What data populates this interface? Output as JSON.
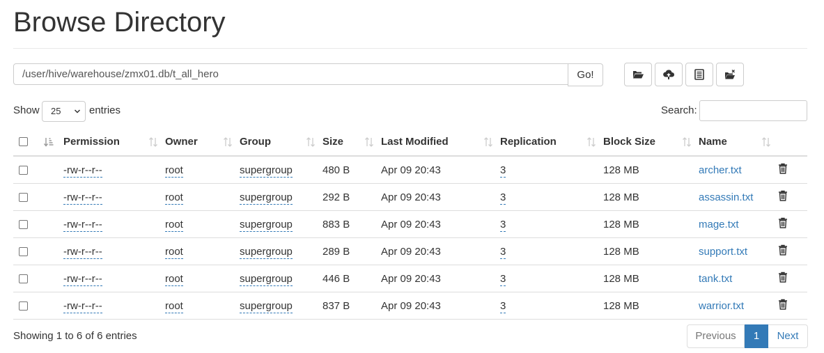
{
  "page_title": "Browse Directory",
  "path": {
    "value": "/user/hive/warehouse/zmx01.db/t_all_hero",
    "go_label": "Go!"
  },
  "toolbar": {
    "icons": [
      "folder-open-icon",
      "cloud-upload-icon",
      "list-alt-icon",
      "cut-folder-icon"
    ]
  },
  "length_menu": {
    "show_label": "Show",
    "selected": "25",
    "entries_label": "entries"
  },
  "search": {
    "label": "Search:",
    "value": ""
  },
  "table": {
    "columns": [
      "Permission",
      "Owner",
      "Group",
      "Size",
      "Last Modified",
      "Replication",
      "Block Size",
      "Name"
    ],
    "rows": [
      {
        "permission": "-rw-r--r--",
        "owner": "root",
        "group": "supergroup",
        "size": "480 B",
        "modified": "Apr 09 20:43",
        "replication": "3",
        "block_size": "128 MB",
        "name": "archer.txt"
      },
      {
        "permission": "-rw-r--r--",
        "owner": "root",
        "group": "supergroup",
        "size": "292 B",
        "modified": "Apr 09 20:43",
        "replication": "3",
        "block_size": "128 MB",
        "name": "assassin.txt"
      },
      {
        "permission": "-rw-r--r--",
        "owner": "root",
        "group": "supergroup",
        "size": "883 B",
        "modified": "Apr 09 20:43",
        "replication": "3",
        "block_size": "128 MB",
        "name": "mage.txt"
      },
      {
        "permission": "-rw-r--r--",
        "owner": "root",
        "group": "supergroup",
        "size": "289 B",
        "modified": "Apr 09 20:43",
        "replication": "3",
        "block_size": "128 MB",
        "name": "support.txt"
      },
      {
        "permission": "-rw-r--r--",
        "owner": "root",
        "group": "supergroup",
        "size": "446 B",
        "modified": "Apr 09 20:43",
        "replication": "3",
        "block_size": "128 MB",
        "name": "tank.txt"
      },
      {
        "permission": "-rw-r--r--",
        "owner": "root",
        "group": "supergroup",
        "size": "837 B",
        "modified": "Apr 09 20:43",
        "replication": "3",
        "block_size": "128 MB",
        "name": "warrior.txt"
      }
    ]
  },
  "footer": {
    "info": "Showing 1 to 6 of 6 entries",
    "prev_label": "Previous",
    "page": "1",
    "next_label": "Next"
  },
  "colors": {
    "link": "#337ab7",
    "active_page": "#337ab7",
    "border": "#dddddd"
  }
}
